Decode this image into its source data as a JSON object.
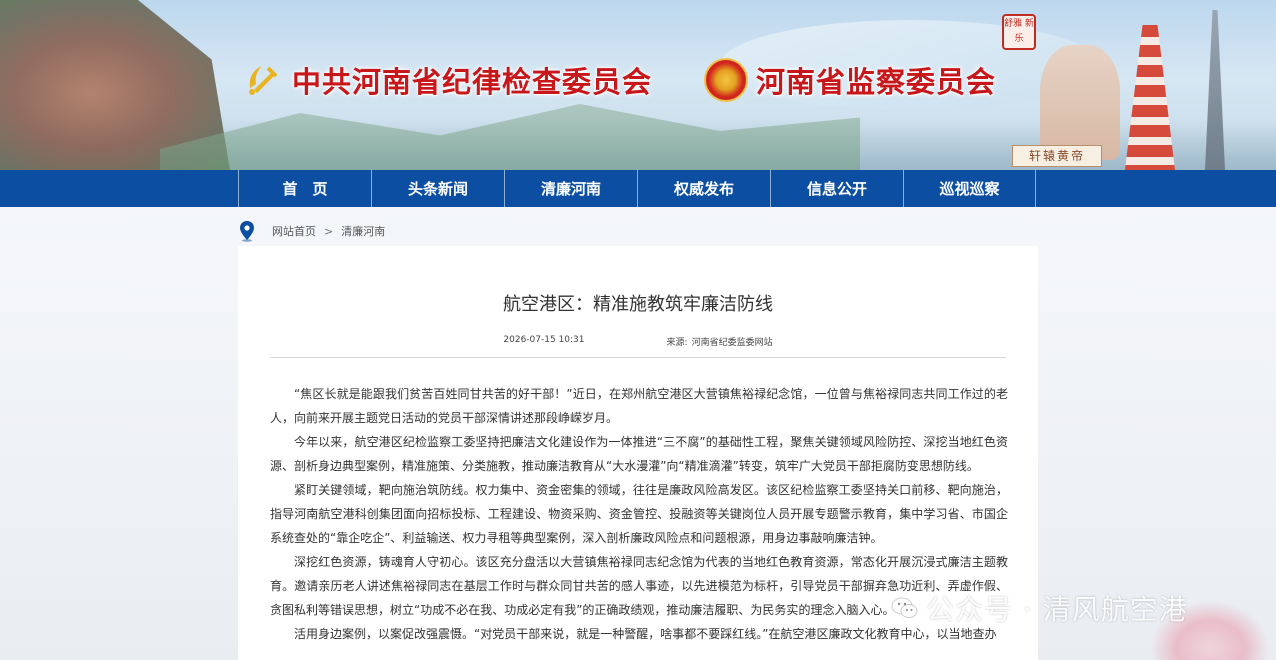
{
  "header": {
    "org_left": "中共河南省纪律检查委员会",
    "org_right": "河南省监察委员会",
    "seal_text": "舒雅 新乐",
    "plaque_text": "轩辕黄帝"
  },
  "nav": {
    "items": [
      {
        "label": "首　页"
      },
      {
        "label": "头条新闻"
      },
      {
        "label": "清廉河南"
      },
      {
        "label": "权威发布"
      },
      {
        "label": "信息公开"
      },
      {
        "label": "巡视巡察"
      }
    ]
  },
  "breadcrumb": {
    "home": "网站首页",
    "separator": ">",
    "current": "清廉河南"
  },
  "article": {
    "title": "航空港区：精准施教筑牢廉洁防线",
    "date": "2026-07-15 10:31",
    "source_label": "来源:",
    "source": "河南省纪委监委网站",
    "paragraphs": [
      "“焦区长就是能跟我们贫苦百姓同甘共苦的好干部！”近日，在郑州航空港区大营镇焦裕禄纪念馆，一位曾与焦裕禄同志共同工作过的老人，向前来开展主题党日活动的党员干部深情讲述那段峥嵘岁月。",
      "今年以来，航空港区纪检监察工委坚持把廉洁文化建设作为一体推进“三不腐”的基础性工程，聚焦关键领域风险防控、深挖当地红色资源、剖析身边典型案例，精准施策、分类施教，推动廉洁教育从“大水漫灌”向“精准滴灌”转变，筑牢广大党员干部拒腐防变思想防线。",
      "紧盯关键领域，靶向施治筑防线。权力集中、资金密集的领域，往往是廉政风险高发区。该区纪检监察工委坚持关口前移、靶向施治，指导河南航空港科创集团面向招标投标、工程建设、物资采购、资金管控、投融资等关键岗位人员开展专题警示教育，集中学习省、市国企系统查处的“靠企吃企”、利益输送、权力寻租等典型案例，深入剖析廉政风险点和问题根源，用身边事敲响廉洁钟。",
      "深挖红色资源，铸魂育人守初心。该区充分盘活以大营镇焦裕禄同志纪念馆为代表的当地红色教育资源，常态化开展沉浸式廉洁主题教育。邀请亲历老人讲述焦裕禄同志在基层工作时与群众同甘共苦的感人事迹，以先进模范为标杆，引导党员干部摒弃急功近利、弄虚作假、贪图私利等错误思想，树立“功成不必在我、功成必定有我”的正确政绩观，推动廉洁履职、为民务实的理念入脑入心。",
      "活用身边案例，以案促改强震慑。“对党员干部来说，就是一种警醒，啥事都不要踩红线。”在航空港区廉政文化教育中心，以当地查办"
    ]
  },
  "watermark": {
    "text": "公众号 · 清风航空港"
  }
}
